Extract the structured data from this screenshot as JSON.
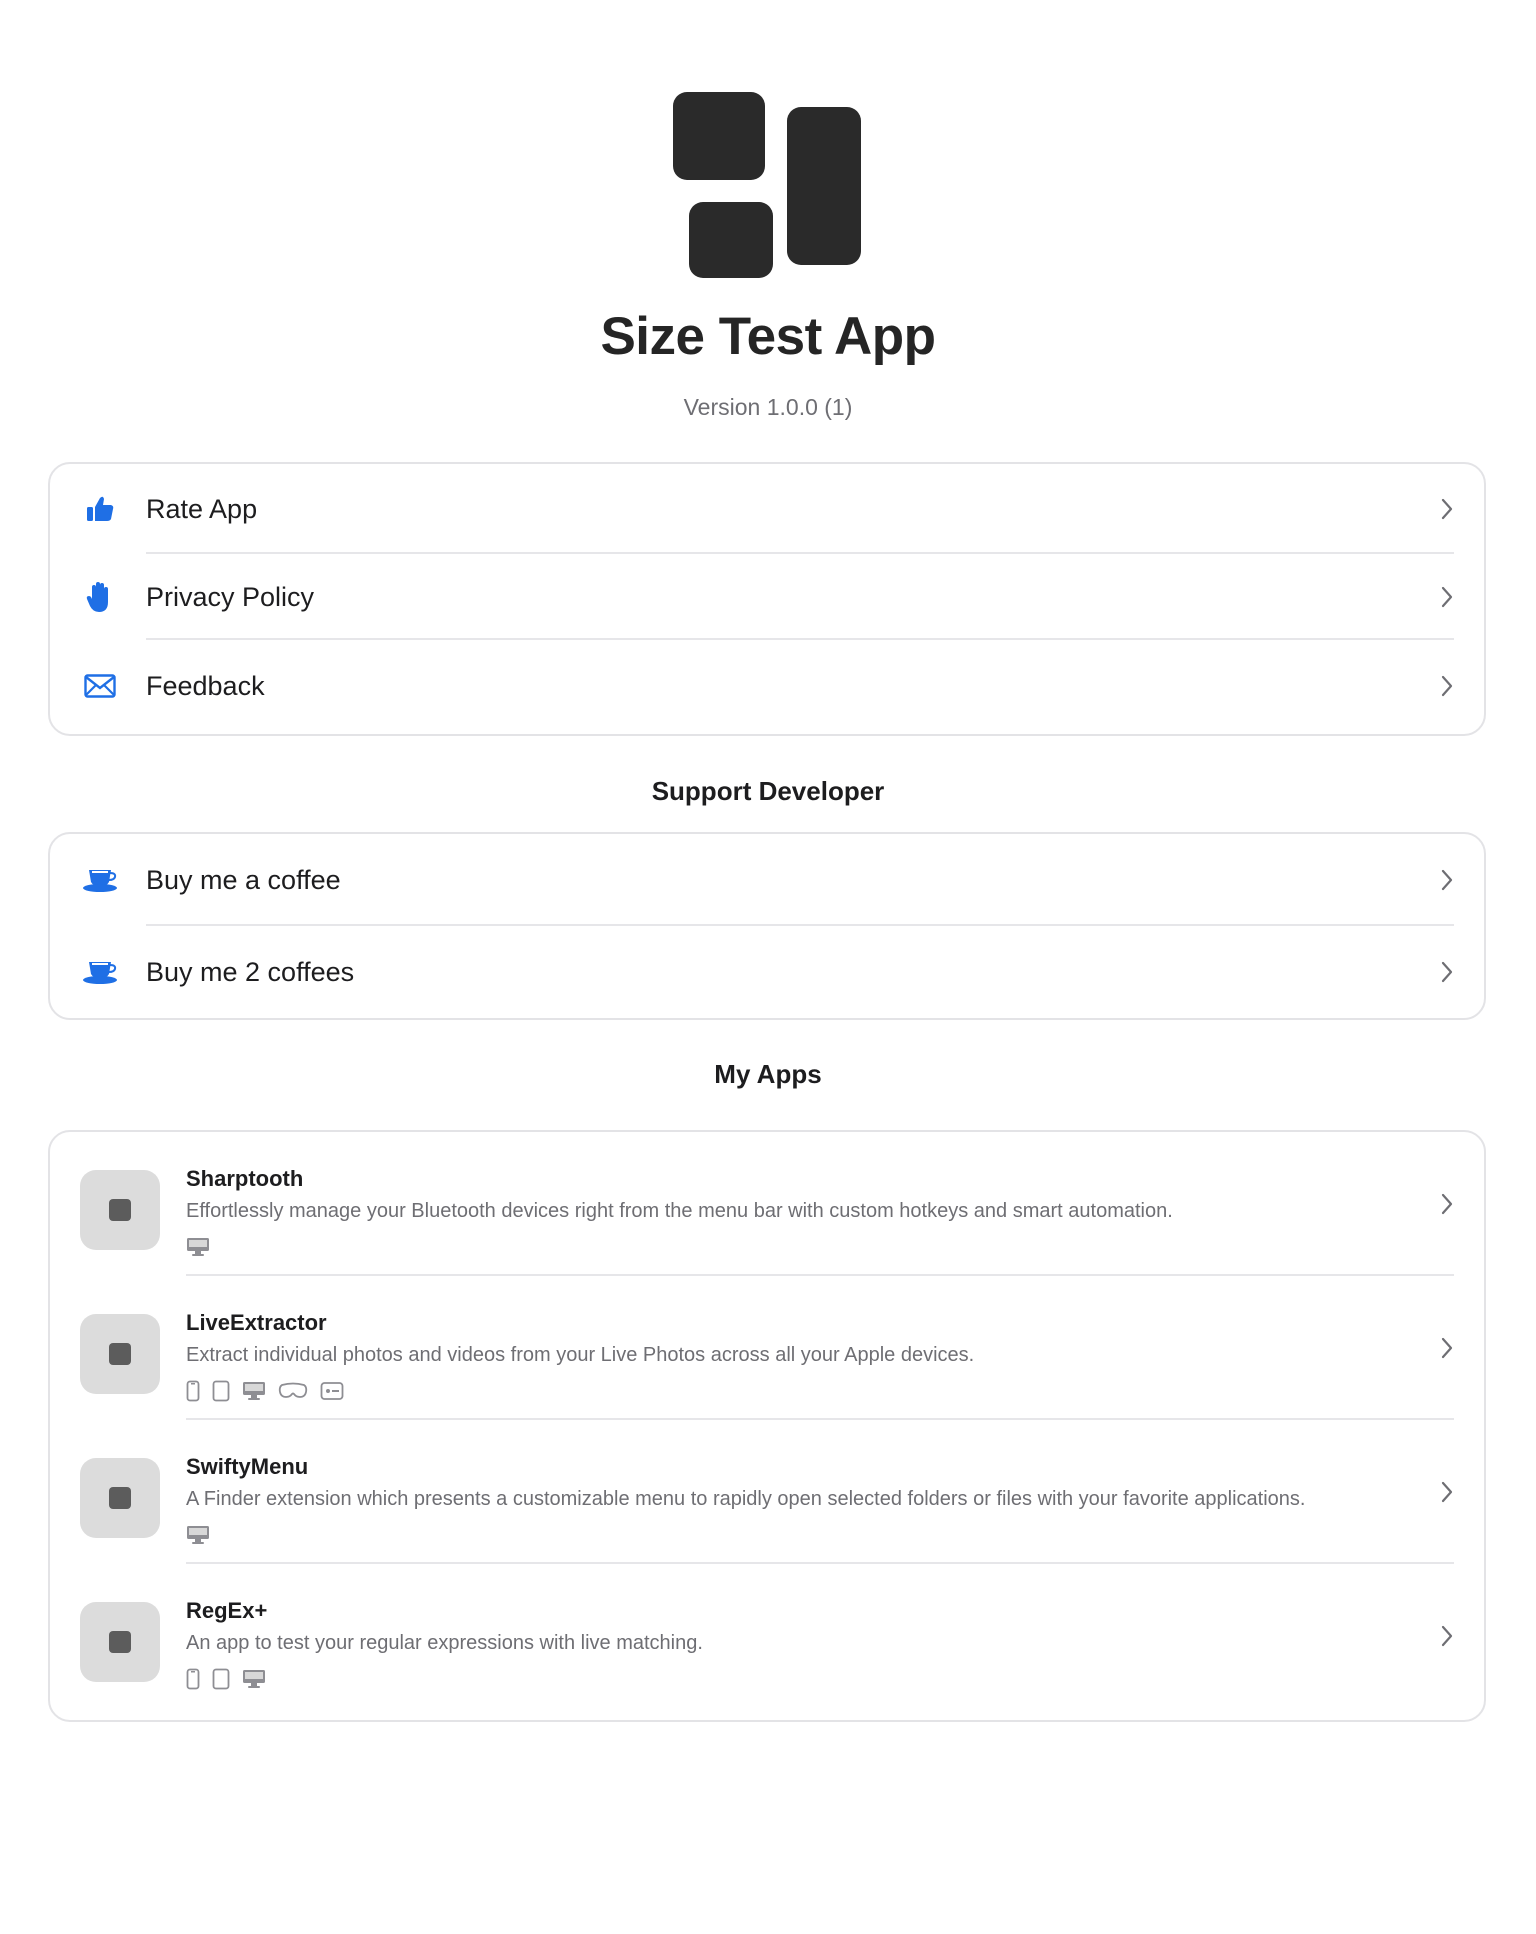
{
  "header": {
    "title": "Size Test App",
    "version": "Version 1.0.0 (1)"
  },
  "general": {
    "items": [
      {
        "label": "Rate App",
        "icon": "thumbs-up-icon"
      },
      {
        "label": "Privacy Policy",
        "icon": "hand-raised-icon"
      },
      {
        "label": "Feedback",
        "icon": "envelope-icon"
      }
    ]
  },
  "support": {
    "title": "Support Developer",
    "items": [
      {
        "label": "Buy me a coffee",
        "icon": "coffee-cup-icon"
      },
      {
        "label": "Buy me 2 coffees",
        "icon": "coffee-cup-icon"
      }
    ]
  },
  "my_apps": {
    "title": "My Apps",
    "apps": [
      {
        "name": "Sharptooth",
        "description": "Effortlessly manage your Bluetooth devices right from the menu bar with custom hotkeys and smart automation.",
        "platforms": [
          "mac-icon"
        ]
      },
      {
        "name": "LiveExtractor",
        "description": "Extract individual photos and videos from your Live Photos across all your Apple devices.",
        "platforms": [
          "iphone-icon",
          "ipad-icon",
          "mac-icon",
          "vision-pro-icon",
          "apple-tv-icon"
        ]
      },
      {
        "name": "SwiftyMenu",
        "description": "A Finder extension which presents a customizable menu to rapidly open selected folders or files with your favorite applications.",
        "platforms": [
          "mac-icon"
        ]
      },
      {
        "name": "RegEx+",
        "description": "An app to test your regular expressions with live matching.",
        "platforms": [
          "iphone-icon",
          "ipad-icon",
          "mac-icon"
        ]
      }
    ]
  },
  "colors": {
    "accent": "#1f6fe5",
    "icon_dark": "#2a2a2a",
    "secondary_text": "#6e6e73",
    "border": "#e3e3e6"
  }
}
